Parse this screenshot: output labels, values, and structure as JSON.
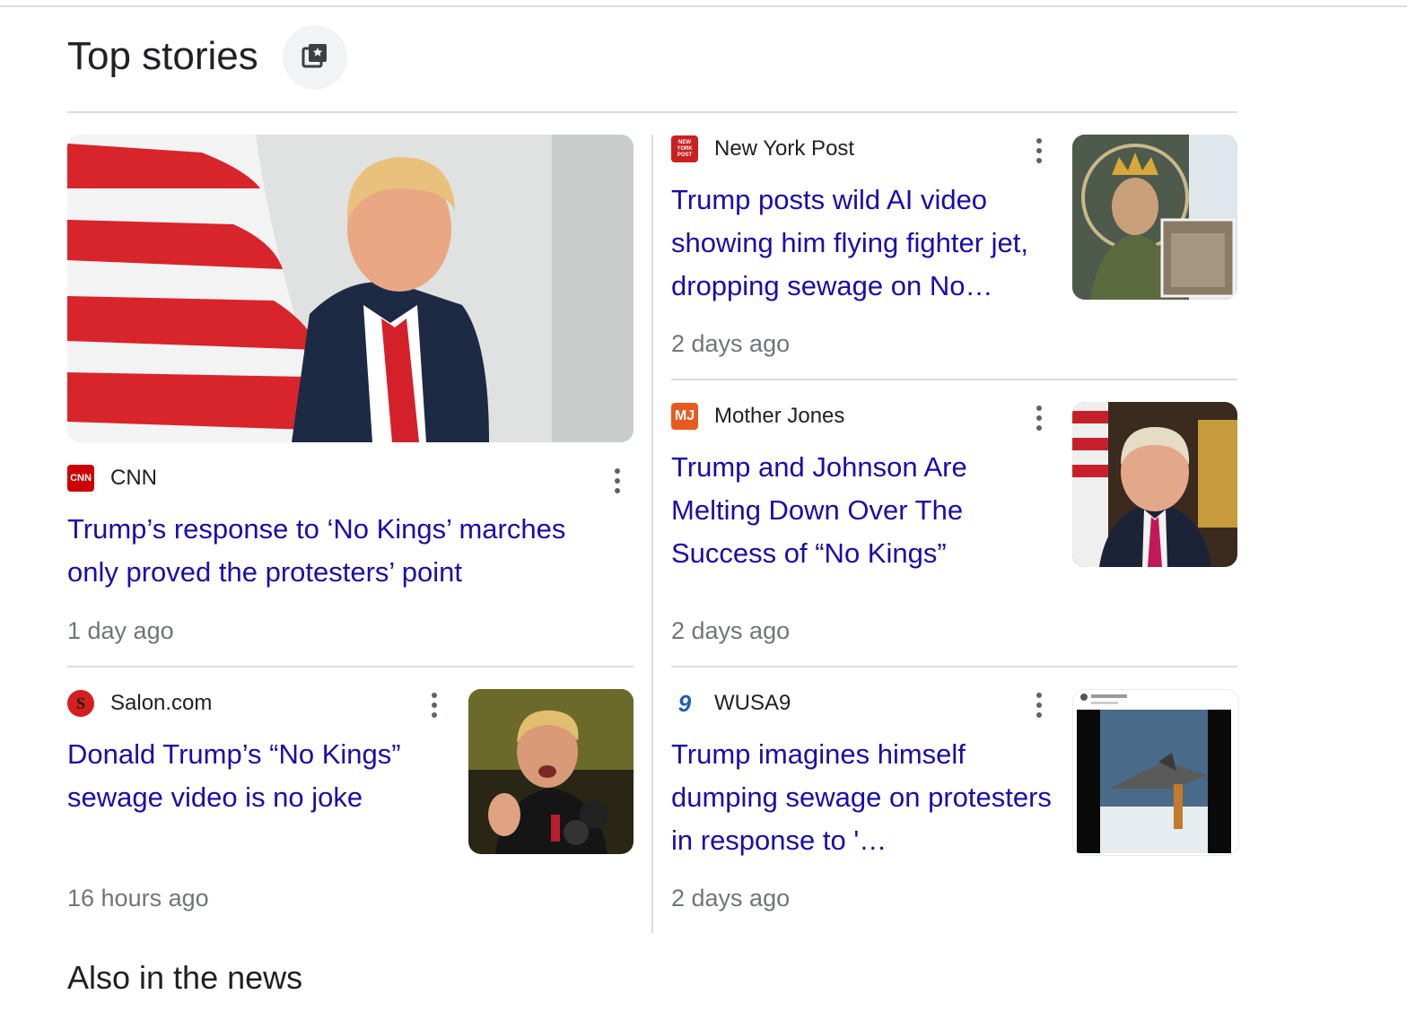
{
  "section": {
    "title": "Top stories",
    "save_icon": "bookmark-stack-icon"
  },
  "stories": [
    {
      "source": "CNN",
      "logo_text": "CNN",
      "logo_color": "#cc0000",
      "headline": "Trump’s response to ‘No Kings’ marches only proved the protesters’ point",
      "time": "1 day ago",
      "image": "trump-with-american-flag"
    },
    {
      "source": "New York Post",
      "logo_text": "NEW YORK POST",
      "logo_color": "#cc1f1f",
      "headline": "Trump posts wild AI video showing him flying fighter jet, dropping sewage on No…",
      "time": "2 days ago",
      "image": "crowned-figure-collage"
    },
    {
      "source": "Mother Jones",
      "logo_text": "MJ",
      "logo_color": "#e85a1e",
      "headline": "Trump and Johnson Are Melting Down Over The Success of “No Kings”",
      "time": "2 days ago",
      "image": "trump-seated-portrait"
    },
    {
      "source": "Salon.com",
      "logo_text": "S",
      "logo_color": "#d41f1f",
      "headline": "Donald Trump’s “No Kings” sewage video is no joke",
      "time": "16 hours ago",
      "image": "trump-speaking-at-microphones"
    },
    {
      "source": "WUSA9",
      "logo_text": "9",
      "logo_color": "#1f5fa8",
      "headline": "Trump imagines himself dumping sewage on protesters in response to '…",
      "time": "2 days ago",
      "image": "social-post-jet-video"
    }
  ],
  "also_in_the_news": "Also in the news",
  "colors": {
    "link": "#1a0dab",
    "meta": "#70757a",
    "divider": "#dadce0"
  }
}
